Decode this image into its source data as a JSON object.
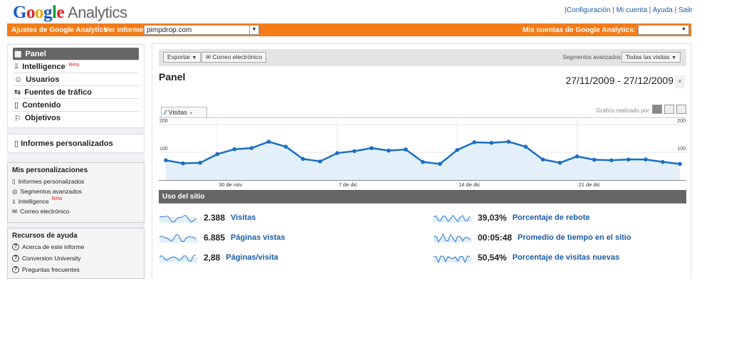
{
  "header": {
    "logo": "Google Analytics",
    "logo_parts": [
      "G",
      "o",
      "o",
      "g",
      "l",
      "e"
    ],
    "logo_product": "Analytics",
    "top_links": [
      "Configuración",
      "Mi cuenta",
      "Ayuda",
      "Salir"
    ]
  },
  "orange_bar": {
    "settings": "Ajustes de Google Analytics",
    "view_reports_label": "Ver informes:",
    "view_reports_value": "pimpdrop.com",
    "accounts_label": "Mis cuentas de Google Analytics:",
    "accounts_value": ""
  },
  "sidebar": {
    "nav": [
      {
        "label": "Panel",
        "icon": "grid-icon",
        "active": true
      },
      {
        "label": "Intelligence",
        "beta": "Beta",
        "icon": "intelligence-icon"
      },
      {
        "label": "Usuarios",
        "icon": "user-icon"
      },
      {
        "label": "Fuentes de tráfico",
        "icon": "traffic-icon"
      },
      {
        "label": "Contenido",
        "icon": "page-icon"
      },
      {
        "label": "Objetivos",
        "icon": "flag-icon"
      }
    ],
    "custom_reports": "Informes personalizados",
    "my_custom": {
      "title": "Mis personalizaciones",
      "items": [
        "Informes personalizados",
        "Segmentos avanzados",
        "Intelligence",
        "Correo electrónico"
      ],
      "beta": "Beta"
    },
    "help": {
      "title": "Recursos de ayuda",
      "items": [
        "Acerca de este informe",
        "Conversion University",
        "Preguntas frecuentes"
      ]
    }
  },
  "toolbar": {
    "export": "Exportar",
    "email": "Correo electrónico",
    "segments_label": "Segmentos avanzados:",
    "segments_value": "Todas las visitas"
  },
  "page": {
    "title": "Panel",
    "date_range": "27/11/2009 - 27/12/2009",
    "metric_tab": "Visitas",
    "graph_by": "Gráfico realizado por:"
  },
  "chart_data": {
    "type": "line",
    "series": [
      {
        "name": "Visitas",
        "values": [
          71,
          60,
          62,
          93,
          111,
          115,
          138,
          120,
          76,
          67,
          97,
          104,
          115,
          106,
          110,
          65,
          58,
          108,
          136,
          134,
          138,
          120,
          74,
          62,
          85,
          73,
          71,
          74,
          74,
          65,
          58
        ]
      }
    ],
    "x_start": "27/11/2009",
    "x_ticks": [
      {
        "label": "30 de nov",
        "index": 3
      },
      {
        "label": "7 de dic",
        "index": 10
      },
      {
        "label": "14 de dic",
        "index": 17
      },
      {
        "label": "21 de dic",
        "index": 24
      }
    ],
    "y_ticks": [
      "200",
      "100"
    ],
    "ylim": [
      0,
      200
    ],
    "grid": true,
    "colors": {
      "line": "#1a6fc4",
      "fill": "#e3f0fa"
    }
  },
  "site_usage": {
    "title": "Uso del sitio",
    "metrics": [
      {
        "value": "2.388",
        "label": "Visitas"
      },
      {
        "value": "6.885",
        "label": "Páginas vistas"
      },
      {
        "value": "2,88",
        "label": "Páginas/visita"
      },
      {
        "value": "39,03%",
        "label": "Porcentaje de rebote"
      },
      {
        "value": "00:05:48",
        "label": "Promedio de tiempo en el sitio"
      },
      {
        "value": "50,54%",
        "label": "Porcentaje de visitas nuevas"
      }
    ]
  }
}
